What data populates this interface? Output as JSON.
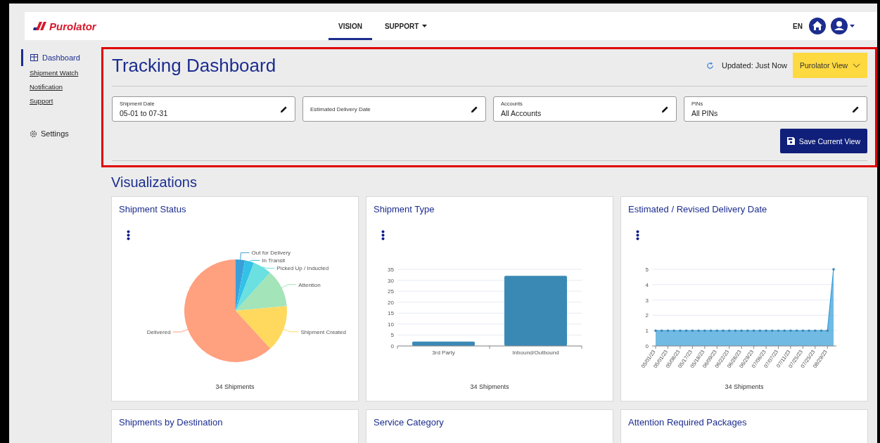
{
  "header": {
    "logo": "Purolator",
    "nav": [
      {
        "label": "VISION",
        "selected": true,
        "has_menu": false
      },
      {
        "label": "SUPPORT",
        "selected": false,
        "has_menu": true
      }
    ],
    "language": "EN"
  },
  "sidebar": {
    "items": [
      {
        "label": "Dashboard",
        "kind": "main",
        "selected": true
      },
      {
        "label": "Shipment Watch",
        "kind": "link",
        "selected": false
      },
      {
        "label": "Notification",
        "kind": "link",
        "selected": false
      },
      {
        "label": "Support",
        "kind": "link",
        "selected": false
      },
      {
        "label": "Settings",
        "kind": "settings",
        "selected": false
      }
    ]
  },
  "dashboard": {
    "title": "Tracking Dashboard",
    "status": "Updated: Just Now",
    "view_selector": "Purolator View",
    "filters": [
      {
        "label": "Shipment Date",
        "value": "05-01 to 07-31"
      },
      {
        "label": "Estimated Delivery Date"
      },
      {
        "label": "Accounts",
        "value": "All Accounts"
      },
      {
        "label": "PINs",
        "value": "All PINs"
      }
    ],
    "save_button": "Save Current View"
  },
  "visualizations": {
    "heading": "Visualizations",
    "cards": [
      {
        "title": "Shipment Status",
        "footer": "34 Shipments",
        "chart_data": {
          "type": "pie",
          "categories": [
            "Out for Delivery",
            "In Transit",
            "Picked Up / Inducted",
            "Attention",
            "Shipment Created",
            "Delivered"
          ],
          "values": [
            2.9,
            2.9,
            5.9,
            11.8,
            14.7,
            61.8
          ],
          "colors": [
            "#3a9fd8",
            "#33c1e8",
            "#6ae0e0",
            "#a3e4b9",
            "#ffd95e",
            "#ffa07f"
          ]
        }
      },
      {
        "title": "Shipment Type",
        "footer": "34 Shipments",
        "chart_data": {
          "type": "bar",
          "categories": [
            "3rd Party",
            "Inbound/Outbound"
          ],
          "series": [
            {
              "color": "#3a89b5",
              "values": [
                2,
                32
              ]
            }
          ],
          "grid": true,
          "ylim": [
            0,
            35
          ],
          "yticks": [
            0,
            5,
            10,
            15,
            20,
            25,
            30,
            35
          ]
        }
      },
      {
        "title": "Estimated / Revised Delivery Date",
        "footer": "34 Shipments",
        "chart_data": {
          "type": "area",
          "categories": [
            "05/01/23",
            null,
            "05/01/23",
            null,
            "05/08/23",
            null,
            "05/17/23",
            null,
            "05/18/23",
            null,
            "06/09/23",
            null,
            "06/22/23",
            null,
            "06/28/23",
            null,
            "06/29/23",
            null,
            "07/06/23",
            null,
            "07/07/23",
            null,
            "07/11/23",
            null,
            "07/25/23",
            null,
            "07/25/23",
            null,
            "08/29/23",
            null
          ],
          "series": [
            {
              "color": "#3a9fd8",
              "values": [
                1,
                1,
                1,
                1,
                1,
                1,
                1,
                1,
                1,
                1,
                1,
                1,
                1,
                1,
                1,
                1,
                1,
                1,
                1,
                1,
                1,
                1,
                1,
                1,
                1,
                1,
                1,
                1,
                1,
                5
              ]
            }
          ],
          "grid": true,
          "ylim": [
            0,
            5
          ],
          "yticks": [
            0,
            1,
            2,
            3,
            4,
            5
          ]
        }
      }
    ],
    "more_cards": [
      {
        "title": "Shipments by Destination"
      },
      {
        "title": "Service Category"
      },
      {
        "title": "Attention Required Packages"
      }
    ]
  }
}
